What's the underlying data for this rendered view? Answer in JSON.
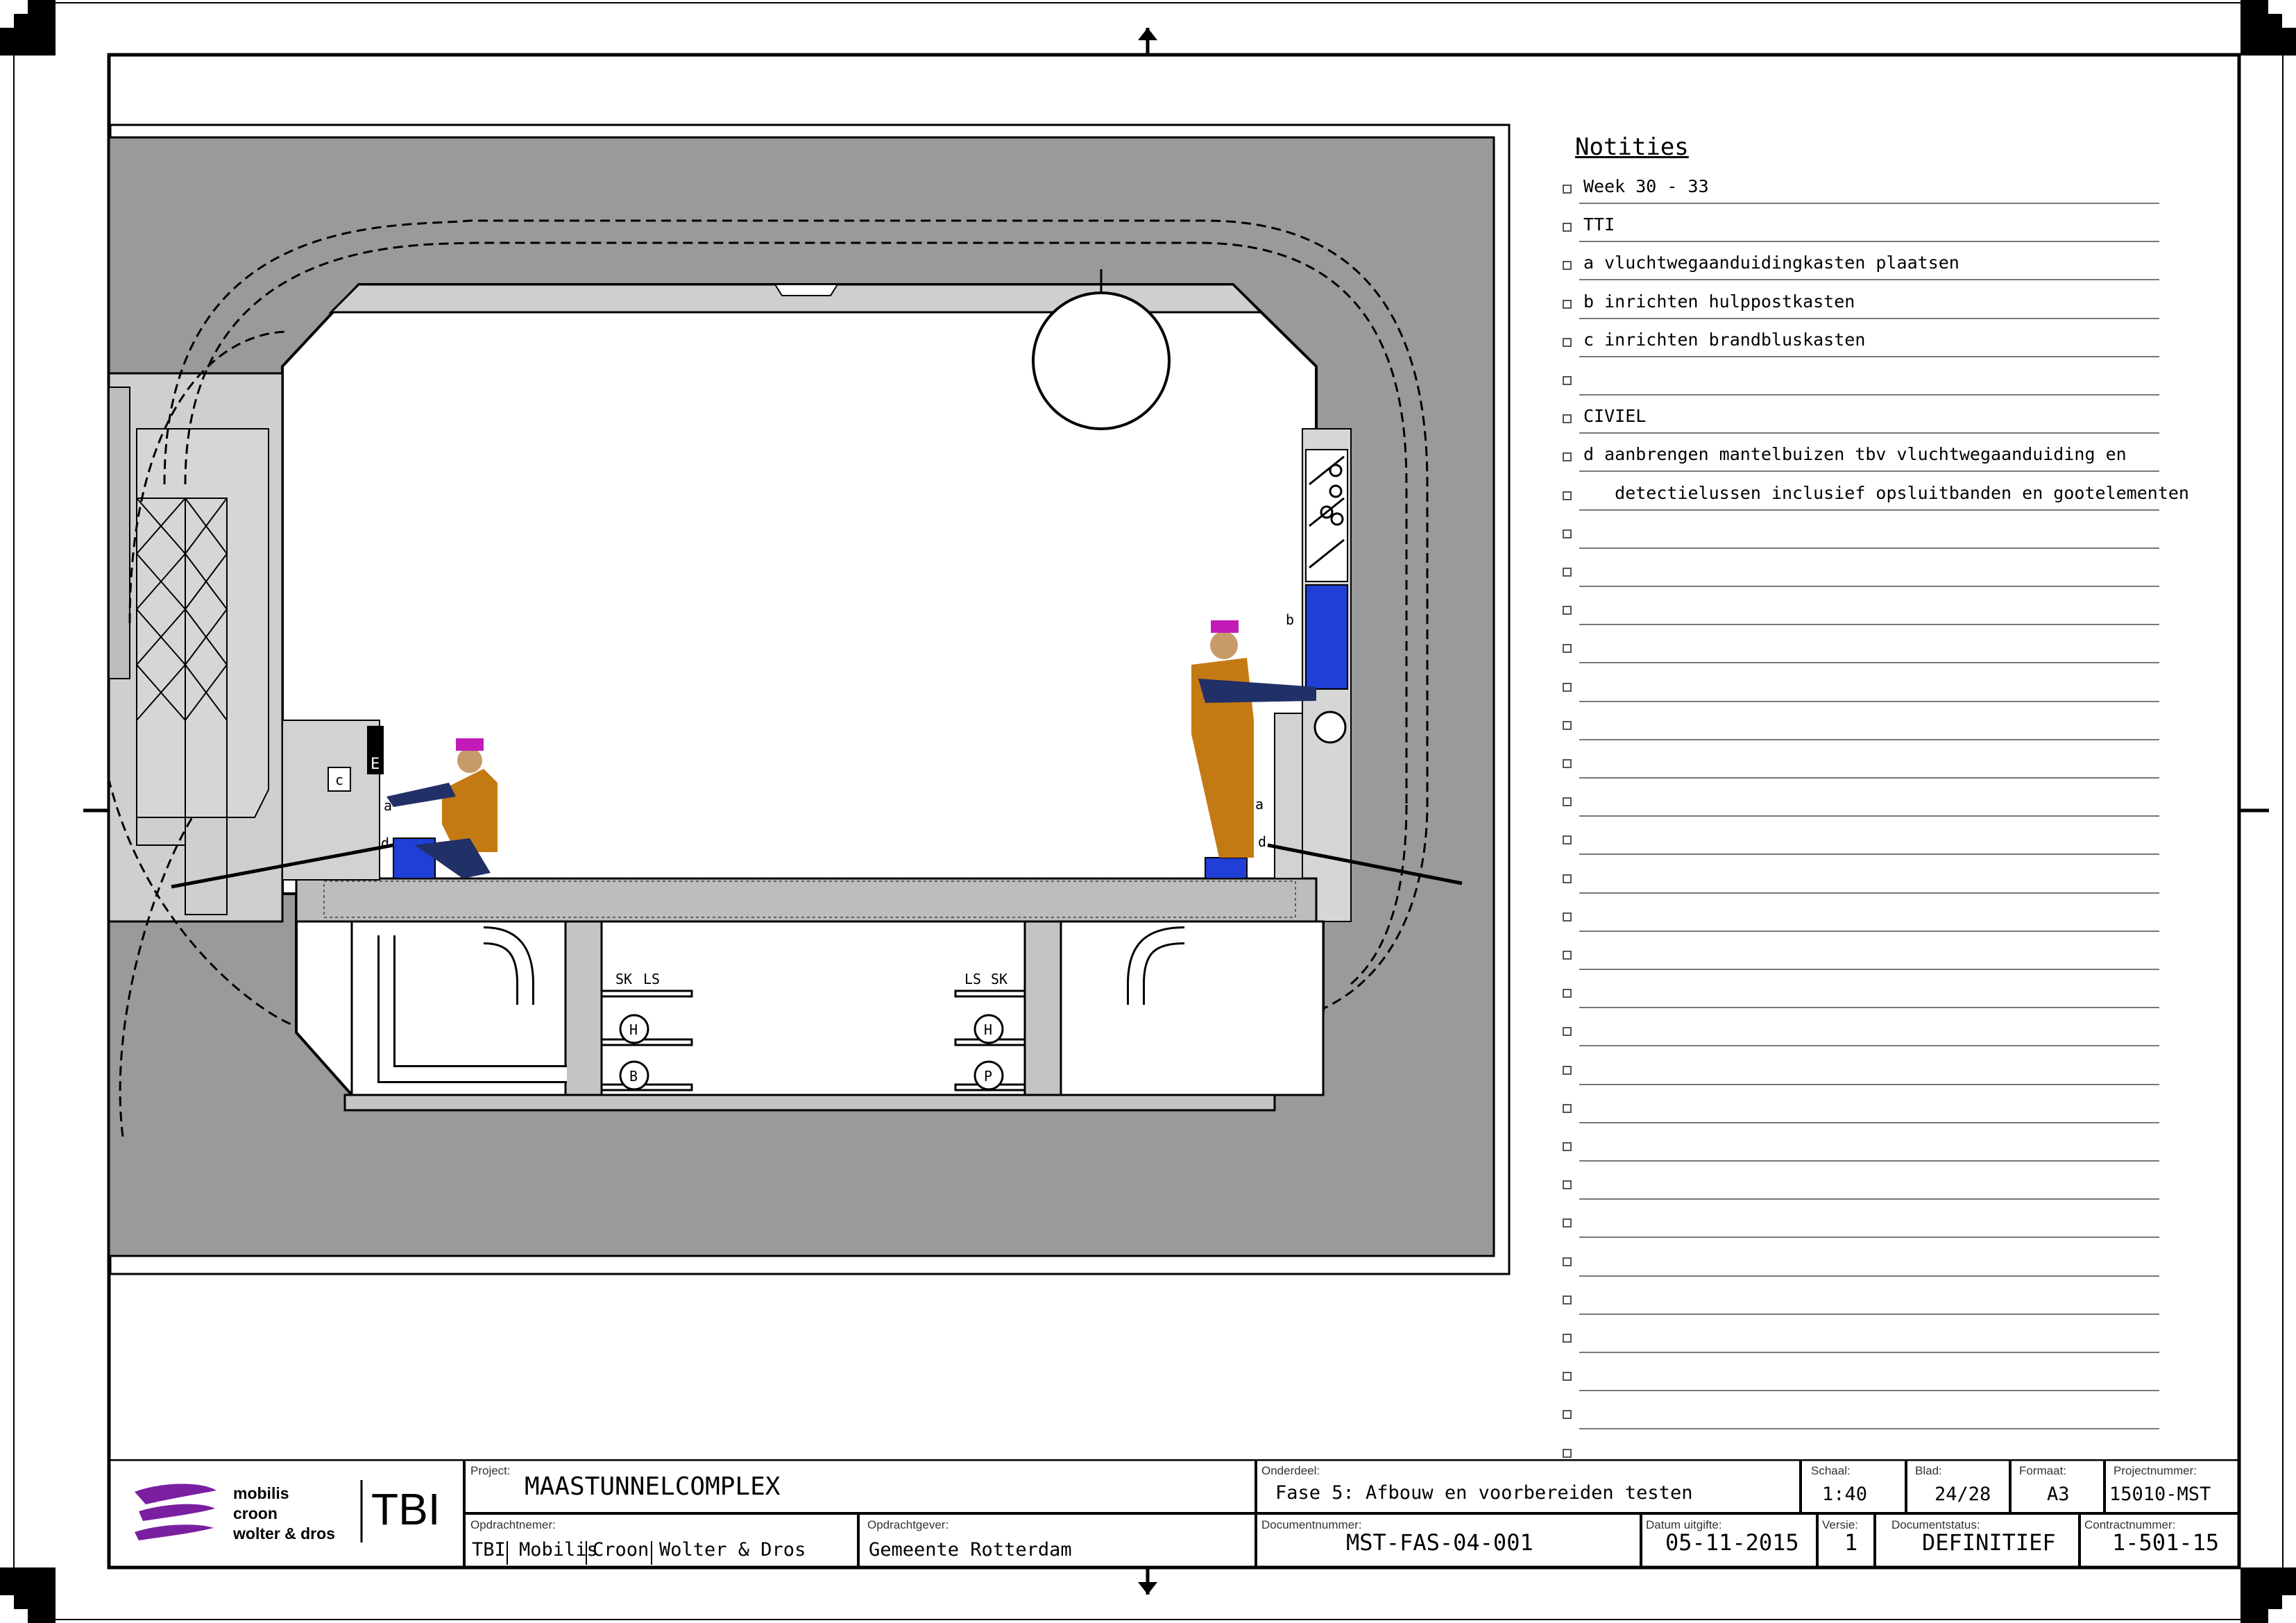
{
  "notes": {
    "title": "Notities",
    "items": [
      "Week 30 - 33",
      "TTI",
      "a vluchtwegaanduidingkasten plaatsen",
      "b inrichten hulppostkasten",
      "c inrichten brandbluskasten",
      "",
      "CIVIEL",
      "d aanbrengen mantelbuizen tbv vluchtwegaanduiding en",
      "   detectielussen inclusief opsluitbanden en gootelementen",
      "",
      "",
      "",
      "",
      "",
      "",
      "",
      "",
      "",
      "",
      "",
      "",
      "",
      "",
      "",
      "",
      "",
      "",
      "",
      "",
      "",
      "",
      "",
      "",
      "",
      "",
      ""
    ]
  },
  "drawing": {
    "labels": {
      "a_left": "a",
      "c_left": "c",
      "d_left": "d",
      "e_left": "E",
      "a_right": "a",
      "b_right": "b",
      "d_right": "d",
      "ls_left": "LS",
      "sk_left": "SK",
      "ls_right": "LS",
      "sk_right": "SK",
      "h_left": "H",
      "b_left": "B",
      "h_right": "H",
      "p_right": "P"
    },
    "colors": {
      "ground": "#9a9a9a",
      "structure": "#c8c8c8",
      "blue": "#1f3fd6",
      "worker_orange": "#c47a12",
      "worker_navy": "#223068",
      "helmet": "#c21cb8",
      "skin": "#c89a6a"
    }
  },
  "titleblock": {
    "logo": {
      "line1": "mobilis",
      "line2": "croon",
      "line3": "wolter & dros",
      "tbi": "TBI"
    },
    "project_label": "Project:",
    "project": "MAASTUNNELCOMPLEX",
    "onderdeel_label": "Onderdeel:",
    "onderdeel": "Fase 5: Afbouw en voorbereiden testen",
    "schaal_label": "Schaal:",
    "schaal": "1:40",
    "blad_label": "Blad:",
    "blad": "24/28",
    "formaat_label": "Formaat:",
    "formaat": "A3",
    "projectnummer_label": "Projectnummer:",
    "projectnummer": "15010-MST",
    "opdrachtnemer_label": "Opdrachtnemer:",
    "opdrachtnemer": [
      "TBI",
      "Mobilis",
      "Croon",
      "Wolter & Dros"
    ],
    "opdrachtgever_label": "Opdrachtgever:",
    "opdrachtgever": "Gemeente Rotterdam",
    "documentnummer_label": "Documentnummer:",
    "documentnummer": "MST-FAS-04-001",
    "datum_label": "Datum uitgifte:",
    "datum": "05-11-2015",
    "versie_label": "Versie:",
    "versie": "1",
    "status_label": "Documentstatus:",
    "status": "DEFINITIEF",
    "contract_label": "Contractnummer:",
    "contract": "1-501-15"
  }
}
